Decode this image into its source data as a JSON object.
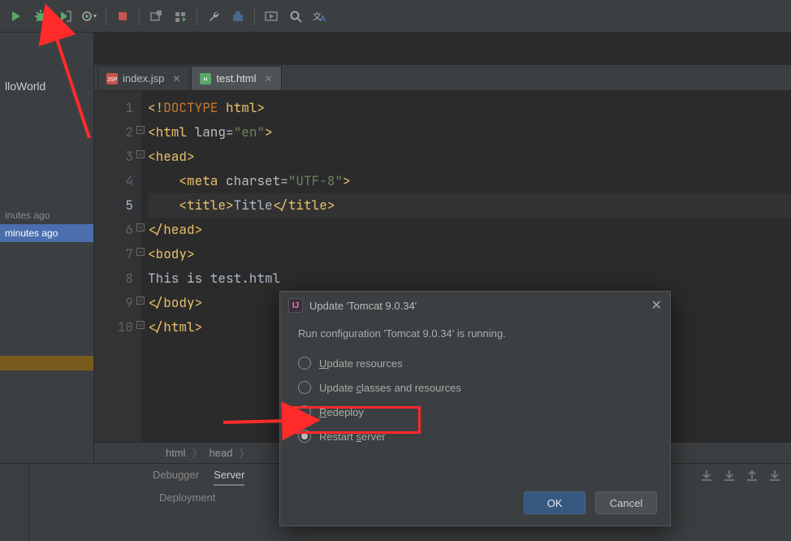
{
  "toolbar": {
    "icons": [
      "run",
      "debug",
      "coverage",
      "profile-dropdown",
      "stop",
      "divider",
      "attach",
      "services",
      "divider",
      "wrench",
      "build",
      "divider",
      "search-everywhere",
      "find",
      "translate"
    ]
  },
  "left": {
    "project": "lloWorld",
    "hist1": "inutes ago",
    "hist2": "minutes ago"
  },
  "tabs": [
    {
      "name": "index.jsp",
      "icon": "jsp",
      "active": false
    },
    {
      "name": "test.html",
      "icon": "html",
      "active": true
    }
  ],
  "code": {
    "lines": [
      {
        "n": 1,
        "html": "<span class='tk-tag'>&lt;!</span><span class='tk-mono'>DOCTYPE </span><span class='tk-tag'>html&gt;</span>"
      },
      {
        "n": 2,
        "html": "<span class='tk-tag'>&lt;html </span><span class='tk-attr'>lang=</span><span class='tk-str'>\"en\"</span><span class='tk-tag'>&gt;</span>",
        "fold": true
      },
      {
        "n": 3,
        "html": "<span class='tk-tag'>&lt;head&gt;</span>",
        "fold": true
      },
      {
        "n": 4,
        "html": "    <span class='tk-tag'>&lt;meta </span><span class='tk-attr'>charset=</span><span class='tk-str'>\"UTF-8\"</span><span class='tk-tag'>&gt;</span>"
      },
      {
        "n": 5,
        "html": "    <span class='tk-tag'>&lt;title&gt;</span><span class='tk-txt'>Title</span><span class='tk-tag'>&lt;/title&gt;</span>",
        "hl": true
      },
      {
        "n": 6,
        "html": "<span class='tk-tag'>&lt;/head&gt;</span>",
        "fold": true
      },
      {
        "n": 7,
        "html": "<span class='tk-tag'>&lt;body&gt;</span>",
        "fold": true
      },
      {
        "n": 8,
        "html": "<span class='tk-txt'>This is test.html</span>"
      },
      {
        "n": 9,
        "html": "<span class='tk-tag'>&lt;/body&gt;</span>",
        "fold": true
      },
      {
        "n": 10,
        "html": "<span class='tk-tag'>&lt;/html&gt;</span>",
        "fold": true
      }
    ],
    "current_line": 5
  },
  "breadcrumb": [
    "html",
    "head"
  ],
  "dialog": {
    "title": "Update 'Tomcat 9.0.34'",
    "message": "Run configuration 'Tomcat 9.0.34' is running.",
    "options": [
      {
        "label": "Update resources",
        "u": 0
      },
      {
        "label": "Update classes and resources",
        "u": 7
      },
      {
        "label": "Redeploy",
        "u": 0
      },
      {
        "label": "Restart server",
        "u": 8
      }
    ],
    "selected": 3,
    "ok": "OK",
    "cancel": "Cancel"
  },
  "bottom": {
    "tabs": [
      "Debugger",
      "Server"
    ],
    "active": 1,
    "sub": "Deployment"
  }
}
